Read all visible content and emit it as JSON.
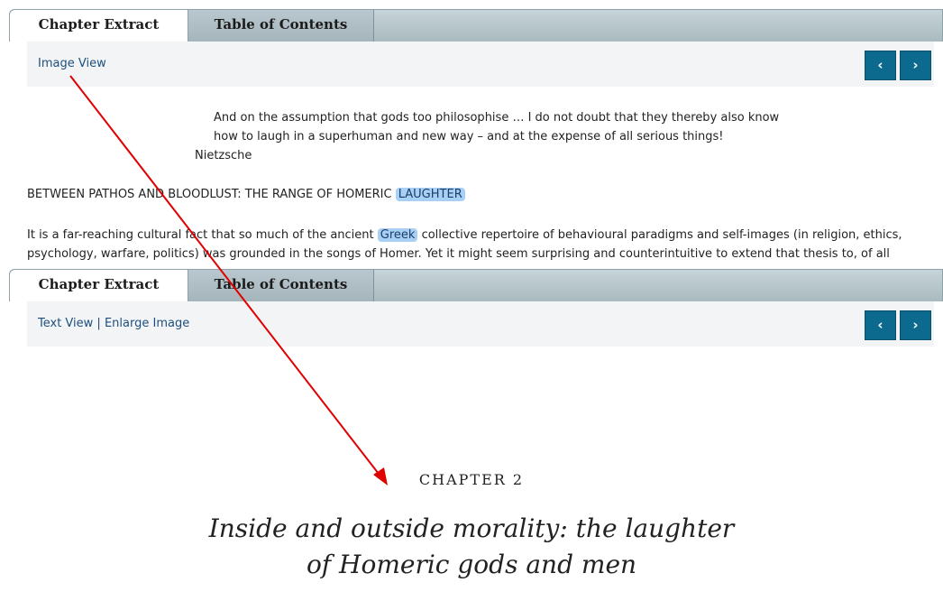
{
  "tabs": {
    "chapter_extract": "Chapter Extract",
    "table_of_contents": "Table of Contents"
  },
  "top_panel": {
    "image_view_link": "Image View",
    "prev_icon": "‹",
    "next_icon": "›",
    "epigraph_line1": "And on the assumption that gods too philosophise … I do not doubt that they thereby also know",
    "epigraph_line2": "how to laugh in a superhuman and new way – and at the expense of all serious things!",
    "epigraph_author": "Nietzsche",
    "heading_prefix": "BETWEEN PATHOS AND BLOODLUST: THE RANGE OF HOMERIC",
    "heading_highlight": "LAUGHTER",
    "para_part1": "It is a far-reaching cultural fact that so much of the ancient",
    "para_highlight": "Greek",
    "para_part2": "collective repertoire of behavioural paradigms and self-images (in religion, ethics,",
    "para_line2": "psychology, warfare, politics) was grounded in the songs of Homer. Yet it might seem surprising and counterintuitive to extend that thesis to, of all"
  },
  "bottom_panel": {
    "text_view_link": "Text View",
    "separator": "|",
    "enlarge_image_link": "Enlarge Image",
    "prev_icon": "‹",
    "next_icon": "›",
    "chapter_label": "CHAPTER 2",
    "title_line1": "Inside and outside morality: the laughter",
    "title_line2": "of Homeric gods and men"
  },
  "colors": {
    "annotation_arrow": "#e00000",
    "nav_button": "#0c6a8f",
    "highlight": "#a8d0f5"
  }
}
